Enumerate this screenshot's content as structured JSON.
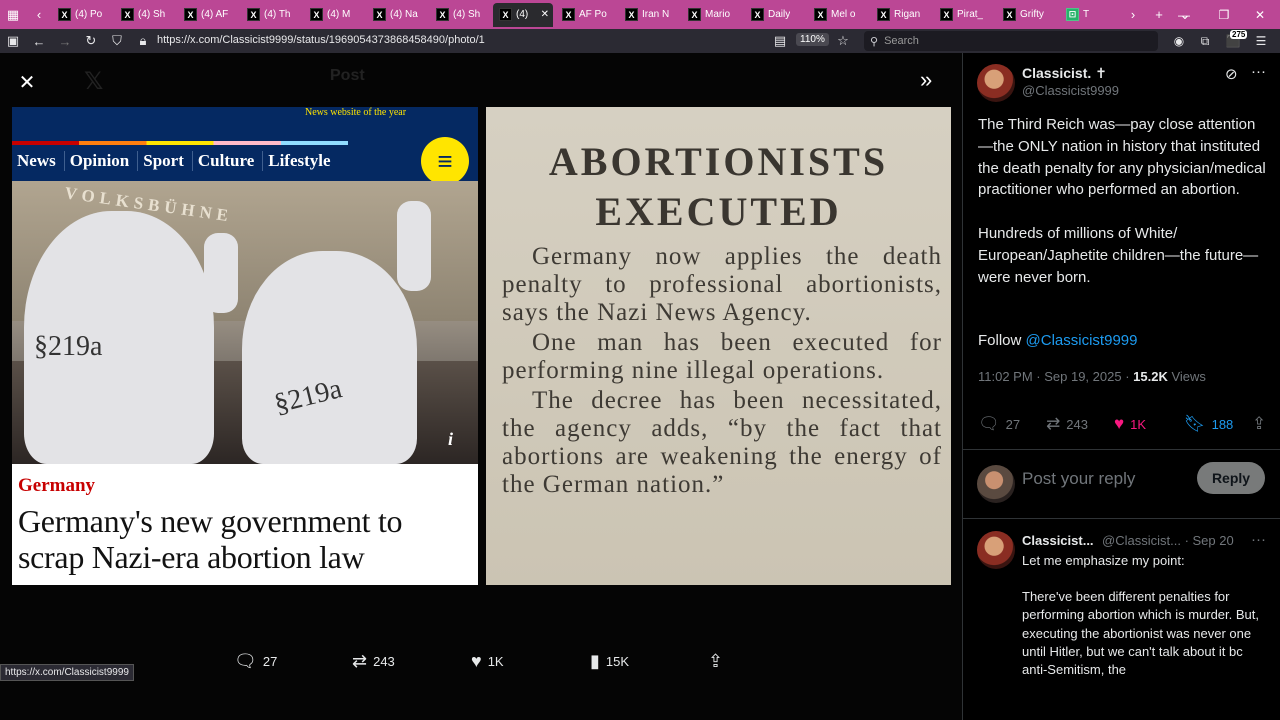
{
  "browser": {
    "tabs": [
      {
        "label": "(4) Po",
        "favicon": "X"
      },
      {
        "label": "(4) Sh",
        "favicon": "X"
      },
      {
        "label": "(4) AF",
        "favicon": "X"
      },
      {
        "label": "(4) Th",
        "favicon": "X"
      },
      {
        "label": "(4) M",
        "favicon": "X"
      },
      {
        "label": "(4) Na",
        "favicon": "X"
      },
      {
        "label": "(4) Sh",
        "favicon": "X"
      },
      {
        "label": "(4)",
        "favicon": "X",
        "active": true
      },
      {
        "label": "AF Po",
        "favicon": "X"
      },
      {
        "label": "Iran N",
        "favicon": "X"
      },
      {
        "label": "Mario",
        "favicon": "X"
      },
      {
        "label": "Daily",
        "favicon": "X"
      },
      {
        "label": "Mel o",
        "favicon": "X"
      },
      {
        "label": "Rigan",
        "favicon": "X"
      },
      {
        "label": "Pirat_",
        "favicon": "X"
      },
      {
        "label": "Grifty",
        "favicon": "X"
      },
      {
        "label": "T",
        "favicon": "⊡"
      }
    ],
    "url": "https://x.com/Classicist9999/status/1969054373868458490/photo/1",
    "zoom": "110%",
    "search_placeholder": "Search",
    "notification_badge": "275",
    "status_link": "https://x.com/Classicist9999",
    "accent_color": "#bb4795"
  },
  "viewer": {
    "ghost_title": "Post",
    "news_image": {
      "award": "News website of the year",
      "nav": [
        "News",
        "Opinion",
        "Sport",
        "Culture",
        "Lifestyle"
      ],
      "building_sign": "VOLKSBÜHNE",
      "suit_labels": [
        "§219a",
        "§219a"
      ],
      "kicker": "Germany",
      "headline": "Germany's new government to scrap Nazi-era abortion law"
    },
    "clipping": {
      "title": "ABORTIONISTS EXECUTED",
      "paragraphs": [
        "Germany now applies the death penalty to professional abortionists, says the Nazi News Agency.",
        "One man has been executed for performing nine illegal operations.",
        "The decree has been necessitated, the agency adds, “by the fact that abortions are weakening the energy of the German nation.”"
      ]
    },
    "actions": {
      "replies": "27",
      "reposts": "243",
      "likes": "1K",
      "views": "15K"
    }
  },
  "tweet": {
    "author_name": "Classicist. ✝",
    "author_handle": "@Classicist9999",
    "text": "The Third Reich was—pay close attention—the ONLY nation in history that instituted the death penalty for any physician/medical practitioner who performed an abortion.\n\nHundreds of millions of White/ European/Japhetite children—the future—were never born.",
    "follow_prefix": "Follow",
    "follow_handle": "@Classicist9999",
    "timestamp": "11:02 PM · Sep 19, 2025",
    "views_count": "15.2K",
    "views_label": "Views",
    "stats": {
      "replies": "27",
      "reposts": "243",
      "likes": "1K",
      "bookmarks": "188"
    },
    "like_color": "#f91880",
    "bookmark_color": "#1d9bf0",
    "reply_placeholder": "Post your reply",
    "reply_button": "Reply"
  },
  "reply": {
    "author_name": "Classicist...",
    "author_handle": "@Classicist...",
    "date": "· Sep 20",
    "paragraphs": [
      "Let me emphasize my point:",
      "There've been different penalties for performing abortion which is murder. But, executing the abortionist was never one until Hitler, but we can't talk about it bc anti-Semitism, the"
    ]
  }
}
